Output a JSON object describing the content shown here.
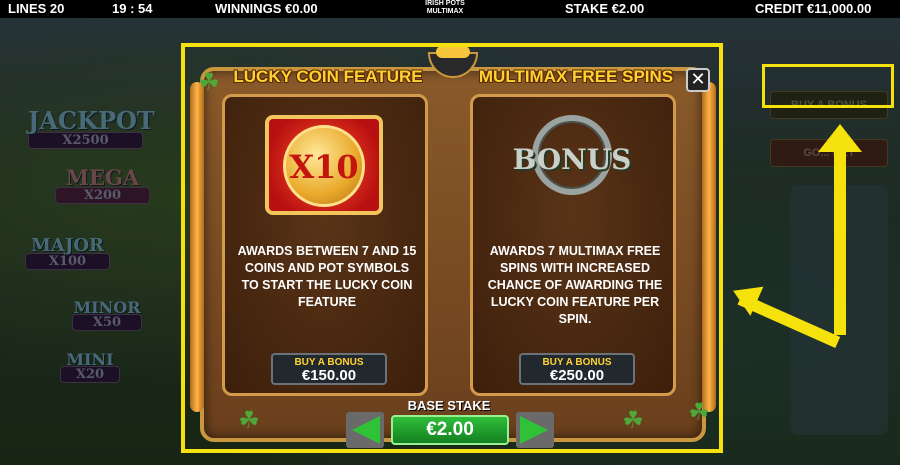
{
  "topbar": {
    "lines": "LINES 20",
    "time": "19 : 54",
    "winnings": "WINNINGS €0.00",
    "logo_line1": "IRISH POTS",
    "logo_line2": "MULTIMAX",
    "stake": "STAKE €2.00",
    "credit": "CREDIT €11,000.00"
  },
  "background": {
    "jackpots": [
      {
        "name": "JACKPOT",
        "mult": "X2500"
      },
      {
        "name": "MEGA",
        "mult": "X200"
      },
      {
        "name": "MAJOR",
        "mult": "X100"
      },
      {
        "name": "MINOR",
        "mult": "X50"
      },
      {
        "name": "MINI",
        "mult": "X20"
      }
    ],
    "buy_bonus_button": "BUY A BONUS",
    "gamble_button": "GO... BET"
  },
  "modal": {
    "features": [
      {
        "title": "LUCKY COIN FEATURE",
        "icon_text": "X10",
        "icon": "lucky-coin-icon",
        "description": "AWARDS BETWEEN 7 AND 15 COINS AND POT SYMBOLS TO START THE LUCKY COIN FEATURE",
        "buy_label": "BUY A BONUS",
        "price": "€150.00"
      },
      {
        "title": "MULTIMAX FREE SPINS",
        "icon_text": "BONUS",
        "icon": "bonus-knot-icon",
        "description": "AWARDS 7 MULTIMAX FREE SPINS WITH INCREASED CHANCE OF AWARDING THE LUCKY COIN FEATURE PER SPIN.",
        "buy_label": "BUY A BONUS",
        "price": "€250.00"
      }
    ],
    "base_stake_label": "BASE STAKE",
    "base_stake_value": "€2.00",
    "close_icon": "close-icon"
  },
  "colors": {
    "highlight": "#f5e10b",
    "title_gold": "#ffd233",
    "stake_green": "#2fbe3a"
  }
}
